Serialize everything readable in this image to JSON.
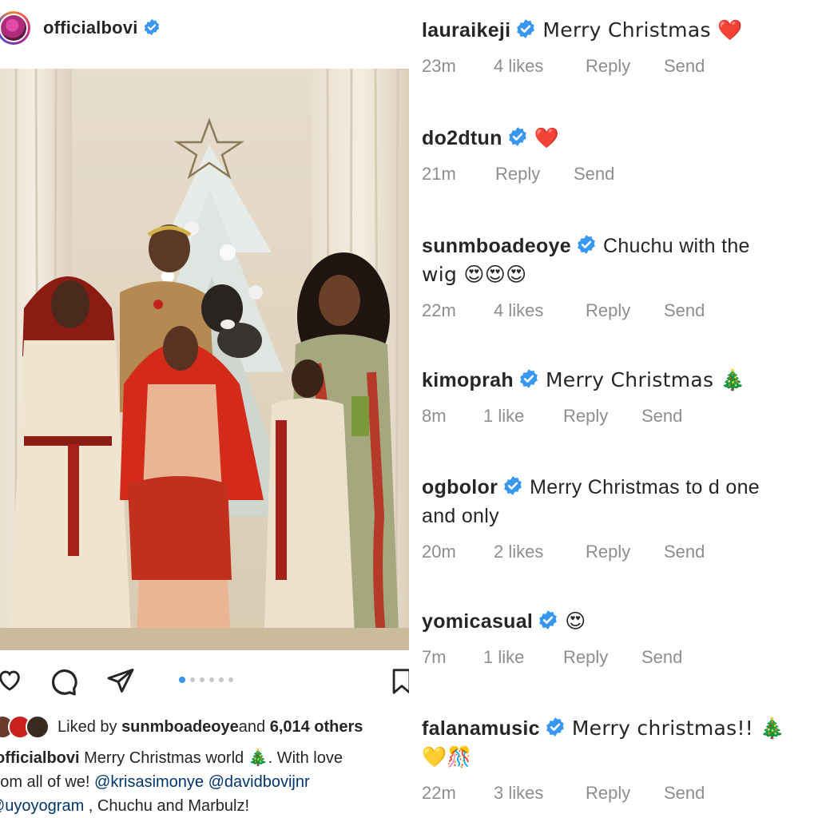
{
  "post": {
    "username": "officialbovi",
    "liked_by_prefix": "Liked by ",
    "liked_by_user": "sunmboadeoye",
    "liked_by_and": " and ",
    "liked_by_others": "6,014 others",
    "caption_user": "officialbovi",
    "caption_line1": " Merry Christmas world 🎄. With love",
    "caption_line2": "from all of we! ",
    "mention1": "@krisasimonye",
    "mention2": "@davidbovijnr",
    "mention3": "@uyoyogram",
    "caption_line3_rest": " , Chuchu and Marbulz!",
    "carousel_count": 6,
    "carousel_active": 1
  },
  "icons": {
    "like": "heart-outline-icon",
    "comment": "comment-bubble-icon",
    "share": "paper-plane-icon",
    "save": "bookmark-icon",
    "verified": "verified-badge-icon"
  },
  "comments": [
    {
      "user": "lauraikeji",
      "text": "Merry Christmas ❤️",
      "time": "23m",
      "likes": "4 likes",
      "reply": "Reply",
      "send": "Send"
    },
    {
      "user": "do2dtun",
      "text": "❤️",
      "time": "21m",
      "likes": "",
      "reply": "Reply",
      "send": "Send"
    },
    {
      "user": "sunmboadeoye",
      "text": "Chuchu with the",
      "text2": "wig 😍😍😍",
      "time": "22m",
      "likes": "4 likes",
      "reply": "Reply",
      "send": "Send"
    },
    {
      "user": "kimoprah",
      "text": "Merry Christmas 🎄",
      "time": "8m",
      "likes": "1 like",
      "reply": "Reply",
      "send": "Send"
    },
    {
      "user": "ogbolor",
      "text": "Merry Christmas to d one",
      "text2": "and only",
      "time": "20m",
      "likes": "2 likes",
      "reply": "Reply",
      "send": "Send"
    },
    {
      "user": "yomicasual",
      "text": "😍",
      "time": "7m",
      "likes": "1 like",
      "reply": "Reply",
      "send": "Send"
    },
    {
      "user": "falanamusic",
      "text": "Merry christmas!! 🎄",
      "text2": "💛🎊",
      "time": "22m",
      "likes": "3 likes",
      "reply": "Reply",
      "send": "Send"
    }
  ],
  "colors": {
    "verified": "#3897f0",
    "meta": "#8e8e8e",
    "text": "#262626",
    "heart": "#ed1c24"
  }
}
